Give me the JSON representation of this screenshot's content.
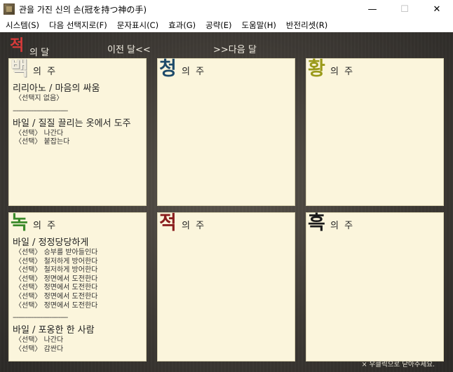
{
  "window": {
    "title": "관을 가진 신의 손(冠を持つ神の手)",
    "controls": {
      "minimize": "—",
      "maximize": "☐",
      "close": "✕"
    }
  },
  "menu": [
    "시스템(S)",
    "다음 선택지로(F)",
    "문자표시(C)",
    "효과(G)",
    "공략(E)",
    "도움말(H)",
    "반전리셋(R)"
  ],
  "nav": {
    "month_char": "적",
    "month_rest": "의 달",
    "prev": "이전 달<<",
    "next": ">>다음 달"
  },
  "colors": {
    "month": "#d83a3a",
    "white_week": "#f2eee0",
    "blue_week": "#1e4a6a",
    "yellow_week": "#9a9a1a",
    "green_week": "#3a8a2a",
    "red_week": "#8a1e1e",
    "black_week": "#1a1a1a"
  },
  "panels": {
    "white": {
      "char": "백",
      "rest": "의 주",
      "routes": [
        {
          "title": "리리아노 / 마음의 싸움",
          "choices": [
            "〈선택지 없음〉"
          ]
        },
        {
          "title": "바일 / 질질 끌리는 옷에서 도주",
          "choices": [
            "〈선택〉 나간다",
            "〈선택〉 붙잡는다"
          ]
        }
      ],
      "divider": "------------------------------"
    },
    "blue": {
      "char": "청",
      "rest": "의 주"
    },
    "yellow": {
      "char": "황",
      "rest": "의 주"
    },
    "green": {
      "char": "녹",
      "rest": "의 주",
      "routes": [
        {
          "title": "바일 / 정정당당하게",
          "choices": [
            "〈선택〉 승부를 받아들인다",
            "〈선택〉 철저하게 방어한다",
            "〈선택〉 철저하게 방어한다",
            "〈선택〉 정면에서 도전한다",
            "〈선택〉 정면에서 도전한다",
            "〈선택〉 정면에서 도전한다",
            "〈선택〉 정면에서 도전한다"
          ]
        },
        {
          "title": "바일 / 포옹한 한 사람",
          "choices": [
            "〈선택〉 나간다",
            "〈선택〉 감싼다"
          ]
        }
      ],
      "divider": "------------------------------"
    },
    "red": {
      "char": "적",
      "rest": "의 주"
    },
    "black": {
      "char": "흑",
      "rest": "의 주"
    }
  },
  "footer_hint": "× 우클릭으로 닫아주세요."
}
